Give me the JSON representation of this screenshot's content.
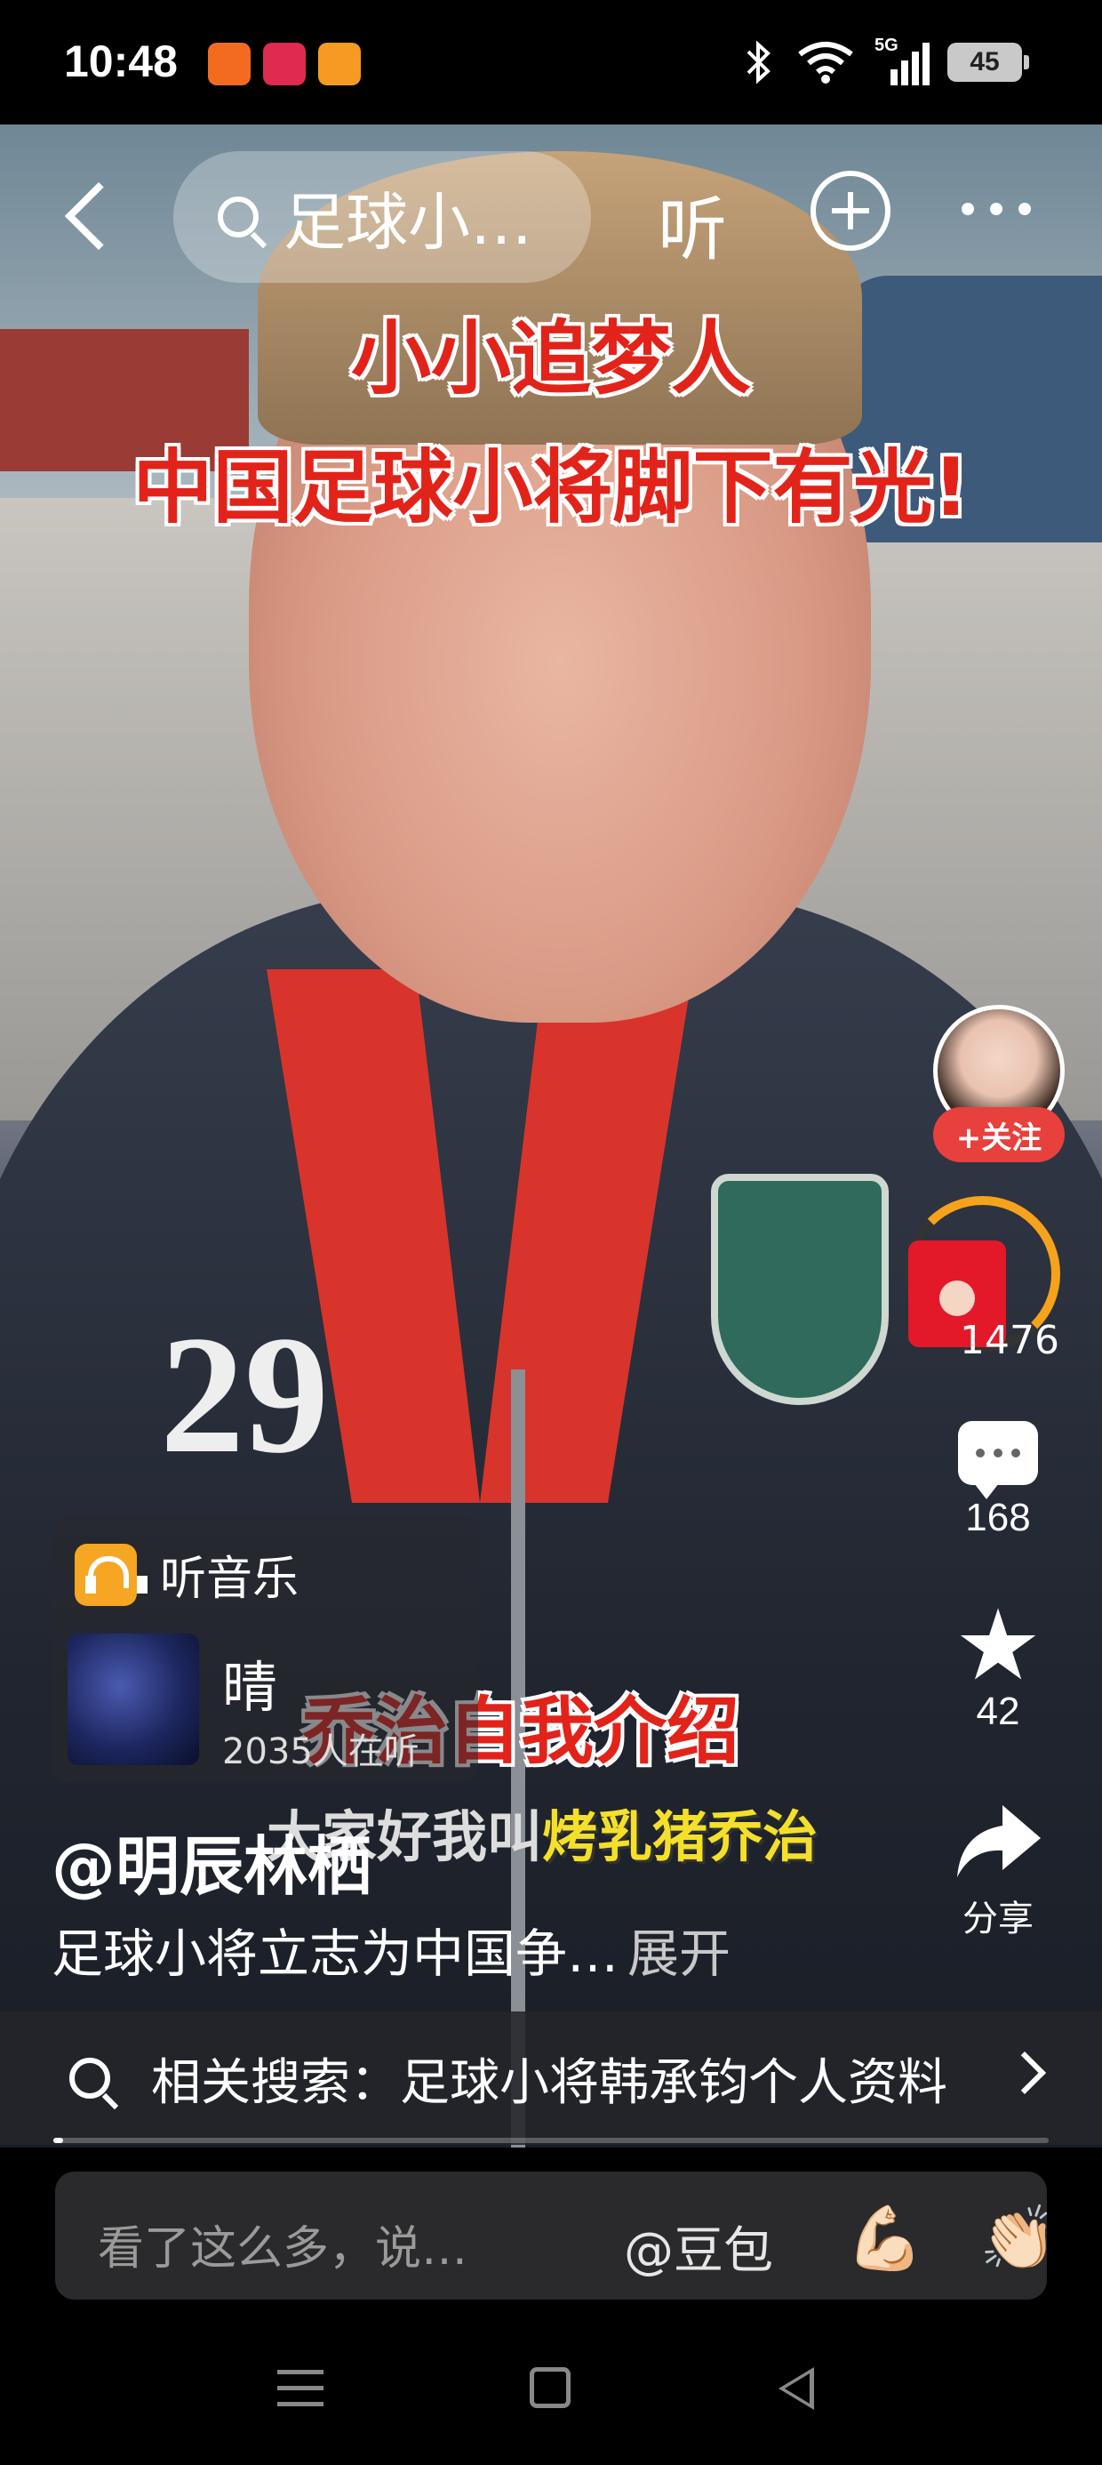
{
  "status_bar": {
    "time": "10:48",
    "app_icons": [
      {
        "name": "app-notification-icon-1",
        "color": "#f36b21"
      },
      {
        "name": "tiktok-icon",
        "color": "#e02a4f"
      },
      {
        "name": "app-notification-icon-2",
        "color": "#f79a23"
      }
    ],
    "network": "5G",
    "battery": "45"
  },
  "top_nav": {
    "search_text": "足球小…",
    "listen_label": "听"
  },
  "video": {
    "title_line1": "小小追梦人",
    "title_line2": "中国足球小将脚下有光!",
    "jersey_number": "29",
    "subtitle_red": "乔治自我介绍",
    "subtitle_line_prefix": "大家好我叫",
    "subtitle_line_highlight": "烤乳猪乔治"
  },
  "right_rail": {
    "follow_label": "+关注",
    "like_count": "1476",
    "comment_count": "168",
    "favorite_count": "42",
    "share_label": "分享"
  },
  "music": {
    "header": "听音乐",
    "title": "晴",
    "listeners": "2035人在听"
  },
  "post": {
    "author": "@明辰林栖",
    "caption": "足球小将立志为中国争…",
    "expand_label": "展开"
  },
  "related_search": {
    "text": "相关搜索：足球小将韩承钧个人资料"
  },
  "playback": {
    "progress": 0.01
  },
  "comment_bar": {
    "placeholder": "看了这么多，说…",
    "mention": "@豆包",
    "emoji_1": "💪🏻",
    "emoji_2": "👏🏻"
  }
}
